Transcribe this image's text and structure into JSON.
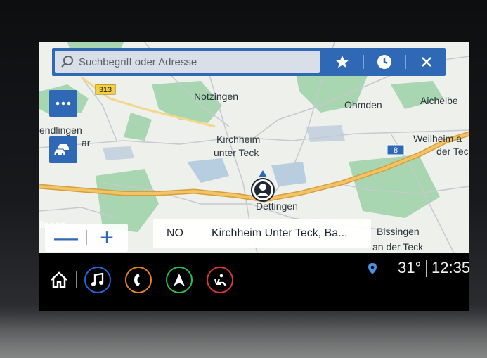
{
  "search": {
    "placeholder": "Suchbegriff oder Adresse"
  },
  "toolbar": {
    "favorites_icon": "star-icon",
    "recent_icon": "clock-icon",
    "close_icon": "close-icon"
  },
  "side_buttons": {
    "menu_icon": "more-dots-icon",
    "traffic_icon": "traffic-car-icon"
  },
  "map": {
    "labels": {
      "notzingen": "Notzingen",
      "ohmden": "Ohmden",
      "aichelberg": "Aichelbe",
      "kirchheim_1": "Kirchheim",
      "kirchheim_2": "unter Teck",
      "weilheim_1": "Weilheim a",
      "weilheim_2": "der Teck",
      "wendlingen_1": "endlingen",
      "wendlingen_2": "ar",
      "dettingen": "Dettingen",
      "bissingen_1": "Bissingen",
      "bissingen_2": "an der Teck",
      "lingen": "lingen"
    },
    "road_shields": {
      "b313": "313",
      "a8": "8"
    }
  },
  "zoom": {
    "out_label": "—",
    "in_label": "+"
  },
  "info": {
    "direction": "NO",
    "address": "Kirchheim Unter Teck, Ba..."
  },
  "nav_bar": {
    "home_icon": "home-icon",
    "apps": [
      {
        "name": "music",
        "icon": "music-note-icon",
        "color": "#2a63d8"
      },
      {
        "name": "phone",
        "icon": "phone-icon",
        "color": "#e8821e"
      },
      {
        "name": "navigation",
        "icon": "navigation-arrow-icon",
        "color": "#2dbb4a"
      },
      {
        "name": "climate",
        "icon": "seat-icon",
        "color": "#d93636"
      }
    ]
  },
  "status": {
    "location_icon": "location-pin-icon",
    "temperature": "31°",
    "time": "12:35"
  },
  "colors": {
    "accent_blue": "#2f69b5",
    "road_yellow": "#e3b758",
    "park_green": "#a8d6b0",
    "water_blue": "#b7cde0"
  }
}
